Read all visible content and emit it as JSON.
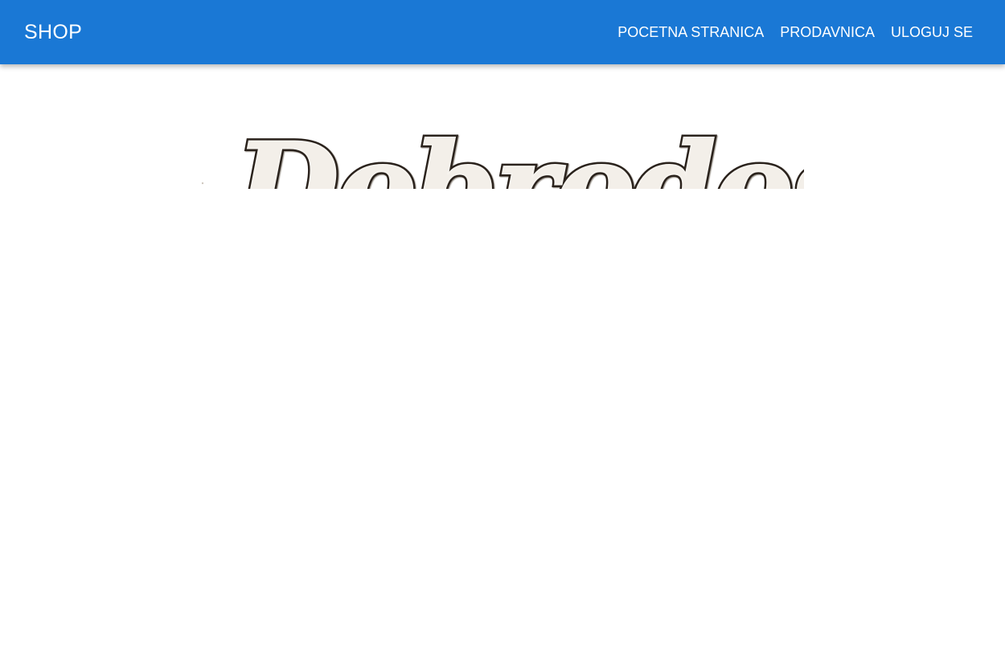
{
  "header": {
    "brand": "SHOP",
    "nav": [
      {
        "label": "POCETNA STRANICA"
      },
      {
        "label": "PRODAVNICA"
      },
      {
        "label": "ULOGUJ SE"
      }
    ]
  },
  "hero": {
    "welcome_text": "Dobrodošli"
  },
  "colors": {
    "navbar": "#1a78d5",
    "nav_text": "#ffffff",
    "background": "#ffffff",
    "wood_fill": "#f3efe9",
    "wood_edge": "#2b241e"
  }
}
